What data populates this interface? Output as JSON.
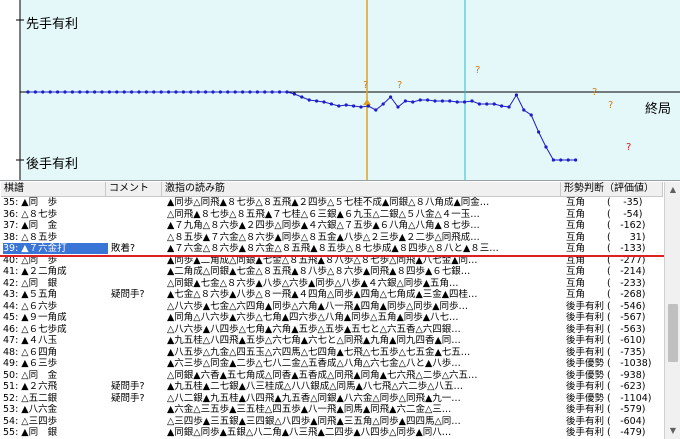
{
  "graph": {
    "label_top": "先手有利",
    "label_bottom": "後手有利",
    "label_end": "終局",
    "line_color": "#1c1cc8",
    "marker_colors": {
      "question": "#d08020",
      "blunder": "#d02020"
    },
    "series": [
      0,
      0,
      0,
      0,
      0,
      0,
      0,
      0,
      0,
      0,
      0,
      0,
      0,
      0,
      0,
      0,
      0,
      0,
      0,
      0,
      0,
      0,
      0,
      0,
      0,
      0,
      0,
      0,
      0,
      0,
      0,
      0,
      0,
      0,
      0,
      0,
      -2,
      -5,
      -8,
      -9,
      -10,
      -12,
      -14,
      -13,
      -14,
      -15,
      -14,
      -18,
      -12,
      -5,
      -15,
      -9,
      -10,
      -8,
      -8,
      -9,
      -9,
      -9,
      -10,
      -10,
      -9,
      -12,
      -12,
      -12,
      -14,
      -15,
      -3,
      -18,
      -23,
      -40,
      -55,
      -68,
      -68,
      -68,
      -68
    ]
  },
  "list": {
    "headers": [
      "棋譜",
      "コメント",
      "激指の読み筋",
      "形勢判断（評価値）"
    ],
    "rows": [
      {
        "move": "35: ▲同　歩",
        "comment": "",
        "line": "▲同歩△同飛▲８七歩△８五飛▲２四歩△５七桂不成▲同銀△８八角成▲同金…",
        "eval": "互角",
        "score": "(　 -35)"
      },
      {
        "move": "36: △８七歩",
        "comment": "",
        "line": "△同飛▲８七歩△８五飛▲７七桂△６三銀▲６九玉△二銀△５八金△４一玉…",
        "eval": "互角",
        "score": "(　 -54)"
      },
      {
        "move": "37: ▲同　金",
        "comment": "",
        "line": "▲７九角△８六歩▲２四歩△同歩▲４六銀△７五歩▲６八角△八角▲８七歩…",
        "eval": "互角",
        "score": "(　-162)"
      },
      {
        "move": "38: △８五歩",
        "comment": "",
        "line": "△８五歩▲７六金△８六歩▲同歩△８五金▲八歩△２三歩▲２二歩△同飛成…",
        "eval": "互角",
        "score": "(　　31)"
      },
      {
        "move": "39: ▲７六金打",
        "comment": "敗着?",
        "line": "▲７六金△８六歩▲８六金△８五飛▲８五歩△８七歩成▲８四歩△８八と▲８三…",
        "eval": "互角",
        "score": "(　-133)"
      },
      {
        "move": "40: △同　歩",
        "comment": "",
        "line": "▲同歩▲二角成△同銀▲七金△８五飛▲８八歩△８七歩△同飛▲八七金▲同…",
        "eval": "互角",
        "score": "(　-277)"
      },
      {
        "move": "41: ▲２二角成",
        "comment": "",
        "line": "▲二角成△同銀▲七金△８五飛▲８八歩△８六歩▲同飛▲８四歩▲６七銀…",
        "eval": "互角",
        "score": "(　-214)"
      },
      {
        "move": "42: △同　銀",
        "comment": "",
        "line": "△同銀▲七金△８六歩▲八歩△六歩▲同歩△八歩▲４六銀△同歩▲五角…",
        "eval": "互角",
        "score": "(　-233)"
      },
      {
        "move": "43: ▲５五角",
        "comment": "疑問手?",
        "line": "▲七金△８六歩▲八歩△８一飛▲４四角△同歩▲四角△七角成▲三金▲四桂…",
        "eval": "互角",
        "score": "(　-268)"
      },
      {
        "move": "44: △６六歩",
        "comment": "",
        "line": "△八六歩▲七金△六四角▲同歩△六角▲八一飛▲四角▲同歩△同歩▲同歩…",
        "eval": "後手有利",
        "score": "(　-546)"
      },
      {
        "move": "45: ▲９一角成",
        "comment": "",
        "line": "▲同角△八六歩▲六歩△七角▲四六歩△八角▲同歩△五角▲同歩▲八七…",
        "eval": "後手有利",
        "score": "(　-567)"
      },
      {
        "move": "46: △６七歩成",
        "comment": "",
        "line": "△八六歩▲八四歩△七角▲六角▲五歩△五歩▲五七と△六五香△六四銀…",
        "eval": "後手有利",
        "score": "(　-563)"
      },
      {
        "move": "47: ▲４八玉",
        "comment": "",
        "line": "▲九五桂△八四飛▲五歩△六七角▲六七と△同飛▲九角▲同九四香▲同…",
        "eval": "後手有利",
        "score": "(　-610)"
      },
      {
        "move": "48: △６四角",
        "comment": "",
        "line": "▲八五歩△九金△四五玉△六四馬△七四角▲七飛△七五歩△七五金▲七五…",
        "eval": "後手有利",
        "score": "(　-735)"
      },
      {
        "move": "49: ▲６三歩",
        "comment": "",
        "line": "▲六三歩△同金▲二歩△七八二金△五香成△八角△六七金△八と▲八歩…",
        "eval": "後手優勢",
        "score": "(　-1038)"
      },
      {
        "move": "50: △同　金",
        "comment": "",
        "line": "△同銀▲六香▲五七角成△同香▲五香成△同飛▲同角▲七六飛△二歩△六五…",
        "eval": "後手優勢",
        "score": "(　-938)"
      },
      {
        "move": "51: ▲２六飛",
        "comment": "疑問手?",
        "line": "▲九五桂▲二七銀▲八三桂成△八八銀成△同馬▲八七飛△六二歩△八五…",
        "eval": "後手有利",
        "score": "(　-623)"
      },
      {
        "move": "52: △五二銀",
        "comment": "疑問手?",
        "line": "△八二銀▲九五桂▲八四飛▲九五香△同銀▲八六金△同歩△同飛▲九一…",
        "eval": "後手優勢",
        "score": "(　-1104)"
      },
      {
        "move": "53: ▲八六金",
        "comment": "",
        "line": "▲六金△三五歩▲三五桂△四五歩▲八一飛▲同馬▲同飛▲六二金△三…",
        "eval": "後手有利",
        "score": "(　-579)"
      },
      {
        "move": "54: △三四歩",
        "comment": "",
        "line": "△三四歩▲三五銀▲三四銀△八四歩▲同飛▲三五角△同歩▲四四馬△同…",
        "eval": "後手有利",
        "score": "(　-604)"
      },
      {
        "move": "55: ▲同　銀",
        "comment": "",
        "line": "▲同銀△同歩▲五銀△八二角▲八三飛▲二四歩▲八四歩△同歩▲同八…",
        "eval": "後手有利",
        "score": "(　-479)"
      }
    ]
  },
  "scrollbar": {
    "up": "▲",
    "down": "▼"
  }
}
